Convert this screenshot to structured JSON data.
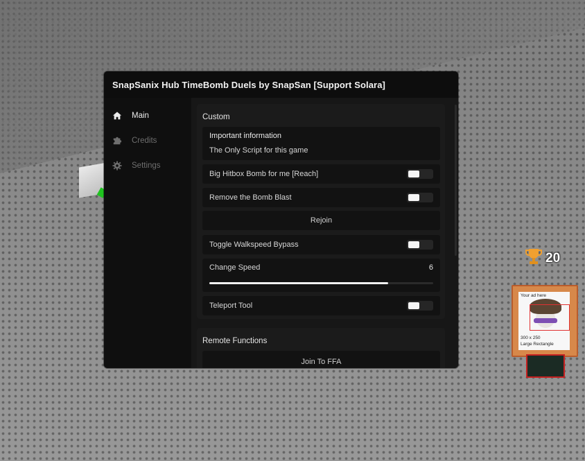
{
  "window": {
    "title": "SnapSanix Hub TimeBomb Duels by SnapSan [Support Solara]"
  },
  "sidebar": {
    "items": [
      {
        "label": "Main",
        "icon": "home-icon",
        "active": true
      },
      {
        "label": "Credits",
        "icon": "puzzle-icon",
        "active": false
      },
      {
        "label": "Settings",
        "icon": "gear-icon",
        "active": false
      }
    ]
  },
  "custom": {
    "section_title": "Custom",
    "info": {
      "title": "Important information",
      "body": "The Only Script for this game"
    },
    "big_hitbox": {
      "label": "Big Hitbox Bomb for me [Reach]",
      "enabled": false
    },
    "remove_blast": {
      "label": "Remove the Bomb Blast",
      "enabled": false
    },
    "rejoin": {
      "label": "Rejoin"
    },
    "walkspeed_bypass": {
      "label": "Toggle Walkspeed Bypass",
      "enabled": false
    },
    "speed": {
      "label": "Change Speed",
      "value": "6",
      "fill_fraction": 0.8
    },
    "teleport_tool": {
      "label": "Teleport Tool",
      "enabled": false
    }
  },
  "remote": {
    "section_title": "Remote Functions",
    "join_ffa": {
      "label": "Join To FFA"
    }
  },
  "hud": {
    "trophy_count": "20",
    "ad_top": "Your ad here",
    "ad_size": "300 x 250",
    "ad_type": "Large Rectangle"
  },
  "colors": {
    "window_bg": "#111111",
    "content_bg": "#171717",
    "toggle_knob": "#f5f5f5",
    "trophy": "#f0a030"
  }
}
